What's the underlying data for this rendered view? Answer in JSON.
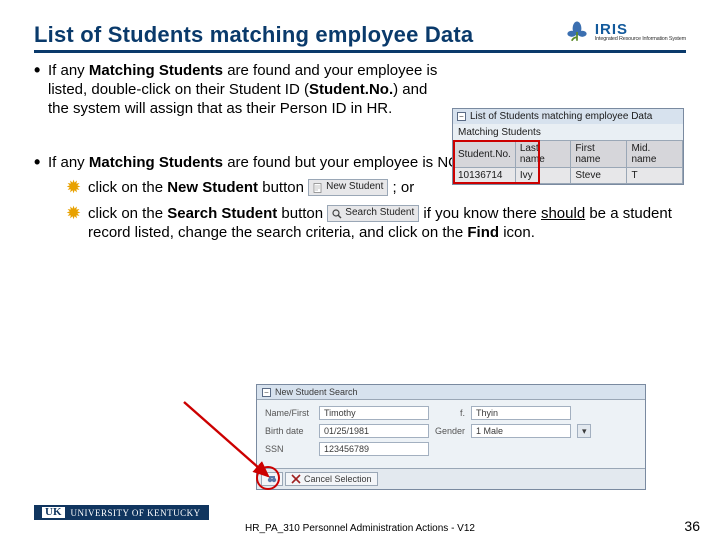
{
  "title": "List of Students matching employee Data",
  "logo": {
    "brand": "IRIS",
    "tagline": "Integrated Resource Information System"
  },
  "bullet1": {
    "pre": "If any ",
    "b1": "Matching Students",
    "mid": " are found and your employee is listed, double-click on their Student ID (",
    "b2": "Student.No.",
    "post": ") and the system will assign that as their Person ID in HR."
  },
  "mini": {
    "titlebar": "List of Students matching employee Data",
    "label": "Matching Students",
    "headers": [
      "Student.No.",
      "Last name",
      "First name",
      "Mid. name"
    ],
    "row": [
      "10136714",
      "Ivy",
      "Steve",
      "T"
    ]
  },
  "bullet2": {
    "pre": "If any ",
    "b1": "Matching Students",
    "post": " are found but your employee is NOT listed,"
  },
  "sub1": {
    "pre": "click on the ",
    "b": "New Student",
    "mid": " button ",
    "btn": "New Student",
    "post": " ; or"
  },
  "sub2": {
    "pre": "click on the ",
    "b": "Search Student",
    "mid": " button ",
    "btn": "Search Student",
    "post_a": " if you know there ",
    "u": "should",
    "post_b": " be a student record listed, change the search criteria, and click on the ",
    "b2": "Find",
    "post_c": " icon."
  },
  "search": {
    "title": "New Student Search",
    "rows": [
      {
        "lab": "Name/First",
        "v1": "Timothy",
        "lab2": "f.",
        "v2": "Thyin"
      },
      {
        "lab": "Birth date",
        "v1": "01/25/1981",
        "lab2": "Gender",
        "v2": "1 Male"
      },
      {
        "lab": "SSN",
        "v1": "123456789",
        "lab2": "",
        "v2": ""
      }
    ],
    "actions": {
      "cancel": "Cancel Selection"
    }
  },
  "footer": {
    "org": "UNIVERSITY OF KENTUCKY",
    "center": "HR_PA_310 Personnel Administration Actions - V12",
    "page": "36"
  }
}
